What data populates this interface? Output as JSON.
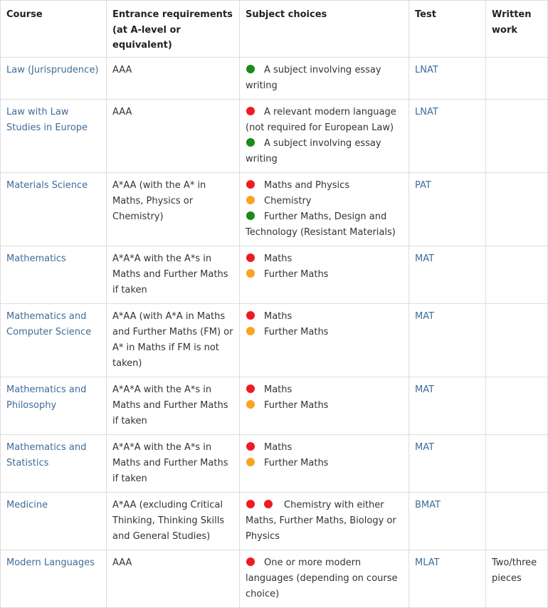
{
  "colors": {
    "red": "#ee1b24",
    "amber": "#f7a520",
    "green": "#1a8a1a",
    "link": "#3f6b9a"
  },
  "headers": {
    "course": "Course",
    "entrance": "Entrance requirements (at A-level or equivalent)",
    "subjects": "Subject choices",
    "test": "Test",
    "written": "Written work"
  },
  "rows": [
    {
      "course": "Law (Jurisprudence)",
      "entrance": "AAA",
      "choices": [
        {
          "dots": [
            "green"
          ],
          "text": "A subject involving essay writing"
        }
      ],
      "test": "LNAT",
      "written": ""
    },
    {
      "course": "Law with Law Studies in Europe",
      "entrance": "AAA",
      "choices": [
        {
          "dots": [
            "red"
          ],
          "text": "A relevant modern language (not required for European Law)"
        },
        {
          "dots": [
            "green"
          ],
          "text": "A subject involving essay writing"
        }
      ],
      "test": "LNAT",
      "written": ""
    },
    {
      "course": "Materials Science",
      "entrance": "A*AA (with the A* in Maths, Physics or Chemistry)",
      "choices": [
        {
          "dots": [
            "red"
          ],
          "text": "Maths and Physics"
        },
        {
          "dots": [
            "amber"
          ],
          "text": "Chemistry"
        },
        {
          "dots": [
            "green"
          ],
          "text": "Further Maths, Design and Technology (Resistant Materials)"
        }
      ],
      "test": "PAT",
      "written": ""
    },
    {
      "course": "Mathematics",
      "entrance": "A*A*A with the A*s in Maths and Further Maths if taken",
      "choices": [
        {
          "dots": [
            "red"
          ],
          "text": "Maths"
        },
        {
          "dots": [
            "amber"
          ],
          "text": "Further Maths"
        }
      ],
      "test": "MAT",
      "written": ""
    },
    {
      "course": "Mathematics and Computer Science",
      "entrance": "A*AA (with A*A in Maths and Further Maths (FM) or A* in Maths if FM is not taken)",
      "choices": [
        {
          "dots": [
            "red"
          ],
          "text": "Maths"
        },
        {
          "dots": [
            "amber"
          ],
          "text": "Further Maths"
        }
      ],
      "test": "MAT",
      "written": ""
    },
    {
      "course": "Mathematics and Philosophy",
      "entrance": "A*A*A with the A*s in Maths and Further Maths if taken",
      "choices": [
        {
          "dots": [
            "red"
          ],
          "text": "Maths"
        },
        {
          "dots": [
            "amber"
          ],
          "text": "Further Maths"
        }
      ],
      "test": "MAT",
      "written": ""
    },
    {
      "course": "Mathematics and Statistics",
      "entrance": "A*A*A with the A*s in Maths and Further Maths if taken",
      "choices": [
        {
          "dots": [
            "red"
          ],
          "text": "Maths"
        },
        {
          "dots": [
            "amber"
          ],
          "text": "Further Maths"
        }
      ],
      "test": "MAT",
      "written": ""
    },
    {
      "course": "Medicine",
      "entrance": "A*AA (excluding Critical Thinking, Thinking Skills and General Studies)",
      "choices": [
        {
          "dots": [
            "red",
            "red"
          ],
          "text": "Chemistry with either Maths, Further Maths, Biology or Physics"
        }
      ],
      "test": "BMAT",
      "written": ""
    },
    {
      "course": "Modern Languages",
      "entrance": "AAA",
      "choices": [
        {
          "dots": [
            "red"
          ],
          "text": "One or more modern languages (depending on course choice)"
        }
      ],
      "test": "MLAT",
      "written": "Two/three pieces"
    }
  ]
}
